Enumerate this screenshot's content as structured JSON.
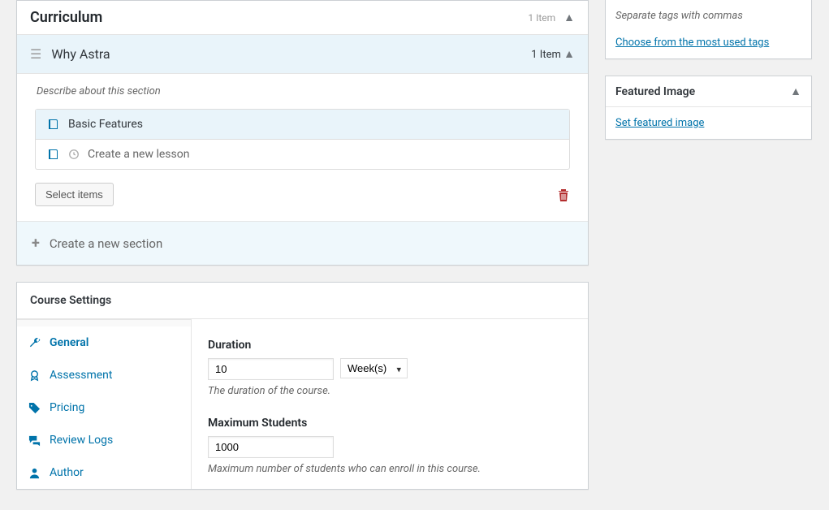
{
  "curriculum": {
    "title": "Curriculum",
    "count_label": "1 Item",
    "sections": [
      {
        "title": "Why Astra",
        "count_label": "1 Item",
        "describe_placeholder": "Describe about this section",
        "lessons": [
          {
            "title": "Basic Features"
          }
        ],
        "new_lesson_label": "Create a new lesson"
      }
    ],
    "select_items_label": "Select items",
    "new_section_label": "Create a new section"
  },
  "course_settings": {
    "title": "Course Settings",
    "tabs": {
      "general": "General",
      "assessment": "Assessment",
      "pricing": "Pricing",
      "review_logs": "Review Logs",
      "author": "Author"
    },
    "duration": {
      "label": "Duration",
      "value": "10",
      "unit": "Week(s)",
      "help": "The duration of the course."
    },
    "max_students": {
      "label": "Maximum Students",
      "value": "1000",
      "help": "Maximum number of students who can enroll in this course."
    }
  },
  "sidebar": {
    "tags": {
      "hint": "Separate tags with commas",
      "choose_link": "Choose from the most used tags"
    },
    "featured_image": {
      "title": "Featured Image",
      "set_link": "Set featured image"
    }
  }
}
